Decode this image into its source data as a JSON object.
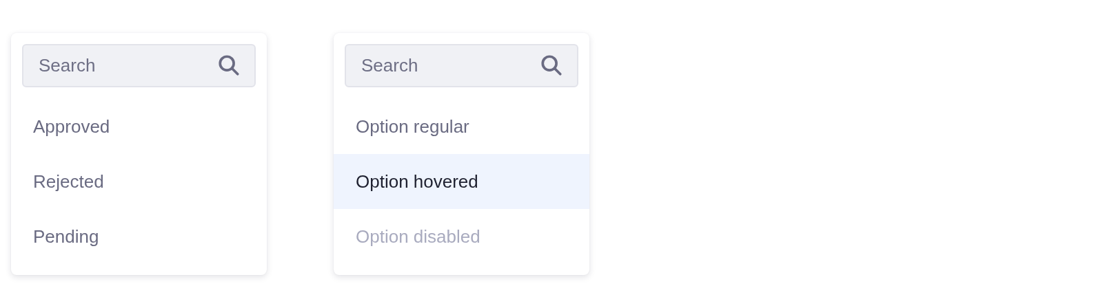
{
  "dropdowns": [
    {
      "search": {
        "placeholder": "Search"
      },
      "options": [
        {
          "label": "Approved",
          "hovered": false,
          "disabled": false
        },
        {
          "label": "Rejected",
          "hovered": false,
          "disabled": false
        },
        {
          "label": "Pending",
          "hovered": false,
          "disabled": false
        }
      ]
    },
    {
      "search": {
        "placeholder": "Search"
      },
      "options": [
        {
          "label": "Option regular",
          "hovered": false,
          "disabled": false
        },
        {
          "label": "Option hovered",
          "hovered": true,
          "disabled": false
        },
        {
          "label": "Option disabled",
          "hovered": false,
          "disabled": true
        }
      ]
    }
  ]
}
